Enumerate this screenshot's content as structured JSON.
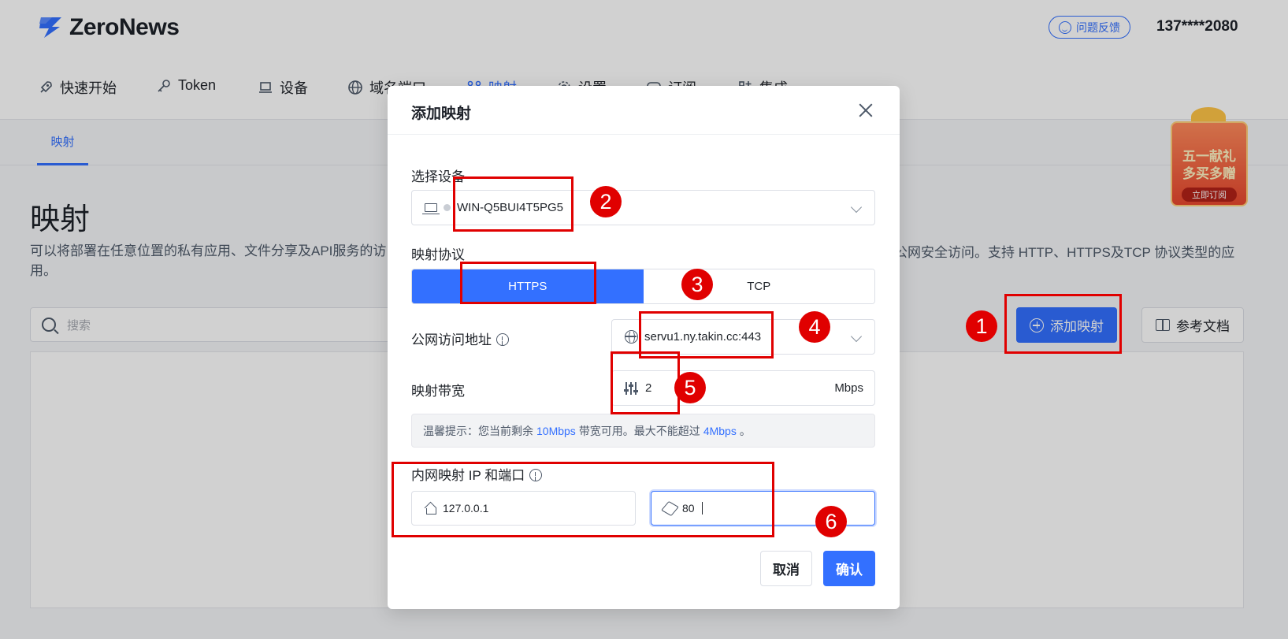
{
  "app": {
    "name": "ZeroNews",
    "feedback_label": "问题反馈",
    "user": "137****2080"
  },
  "nav": [
    {
      "label": "快速开始",
      "icon": "rocket-icon"
    },
    {
      "label": "Token",
      "icon": "key-icon"
    },
    {
      "label": "设备",
      "icon": "laptop-icon"
    },
    {
      "label": "域名端口",
      "icon": "globe-icon"
    },
    {
      "label": "映射",
      "icon": "mapping-icon",
      "active": true
    },
    {
      "label": "设置",
      "icon": "gear-icon"
    },
    {
      "label": "订阅",
      "icon": "chat-icon"
    },
    {
      "label": "集成",
      "icon": "integration-icon"
    }
  ],
  "subtab": "映射",
  "page": {
    "title": "映射",
    "desc_left": "可以将部署在任意位置的私有应用、文件分享及API服务的访",
    "desc_right": "公网安全访问。支持 HTTP、HTTPS及TCP 协议类型的应",
    "desc_line2": "用。",
    "search_placeholder": "搜索",
    "add_label": "添加映射",
    "docs_label": "参考文档"
  },
  "promo": {
    "line1": "五一献礼",
    "line2": "多买多赠",
    "cta": "立即订阅"
  },
  "modal": {
    "title": "添加映射",
    "device_label": "选择设备",
    "device_value": "WIN-Q5BUI4T5PG5",
    "protocol_label": "映射协议",
    "protocols": [
      "HTTPS",
      "TCP"
    ],
    "protocol_selected": "HTTPS",
    "address_label": "公网访问地址",
    "address_value": "servu1.ny.takin.cc:443",
    "bandwidth_label": "映射带宽",
    "bandwidth_value": "2",
    "bandwidth_unit": "Mbps",
    "tip_prefix": "温馨提示：您当前剩余",
    "tip_remaining": "10Mbps",
    "tip_middle": "带宽可用。最大不能超过",
    "tip_max": "4Mbps",
    "tip_suffix": "。",
    "internal_label": "内网映射 IP 和端口",
    "ip_value": "127.0.0.1",
    "port_value": "80",
    "cancel_label": "取消",
    "confirm_label": "确认"
  },
  "annotations": [
    "1",
    "2",
    "3",
    "4",
    "5",
    "6"
  ],
  "colors": {
    "accent": "#3370ff",
    "annotation": "#e00000"
  }
}
